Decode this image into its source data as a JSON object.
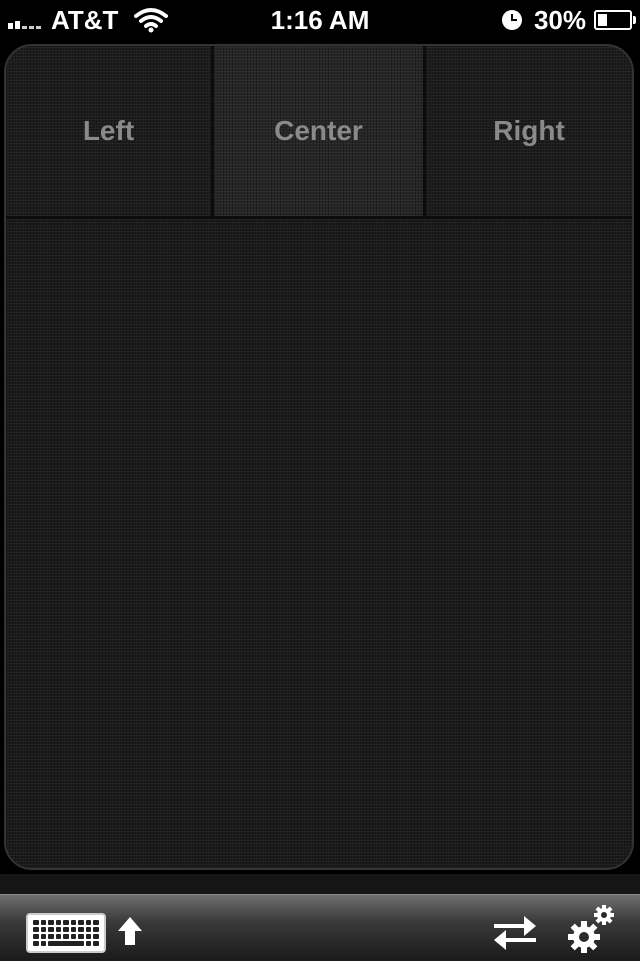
{
  "status_bar": {
    "carrier": "AT&T",
    "time": "1:16 AM",
    "battery_percent": "30%",
    "battery_level": 0.3,
    "icons": [
      "signal-icon",
      "wifi-icon",
      "clock-icon",
      "battery-icon"
    ]
  },
  "trackpad": {
    "buttons": {
      "left": "Left",
      "center": "Center",
      "right": "Right"
    }
  },
  "toolbar": {
    "icons": [
      "keyboard-icon",
      "shift-arrow-icon",
      "swap-arrows-icon",
      "gears-icon"
    ]
  },
  "colors": {
    "button_text": "#8a8a8a",
    "surface": "#1a1a1a",
    "background": "#000000"
  }
}
